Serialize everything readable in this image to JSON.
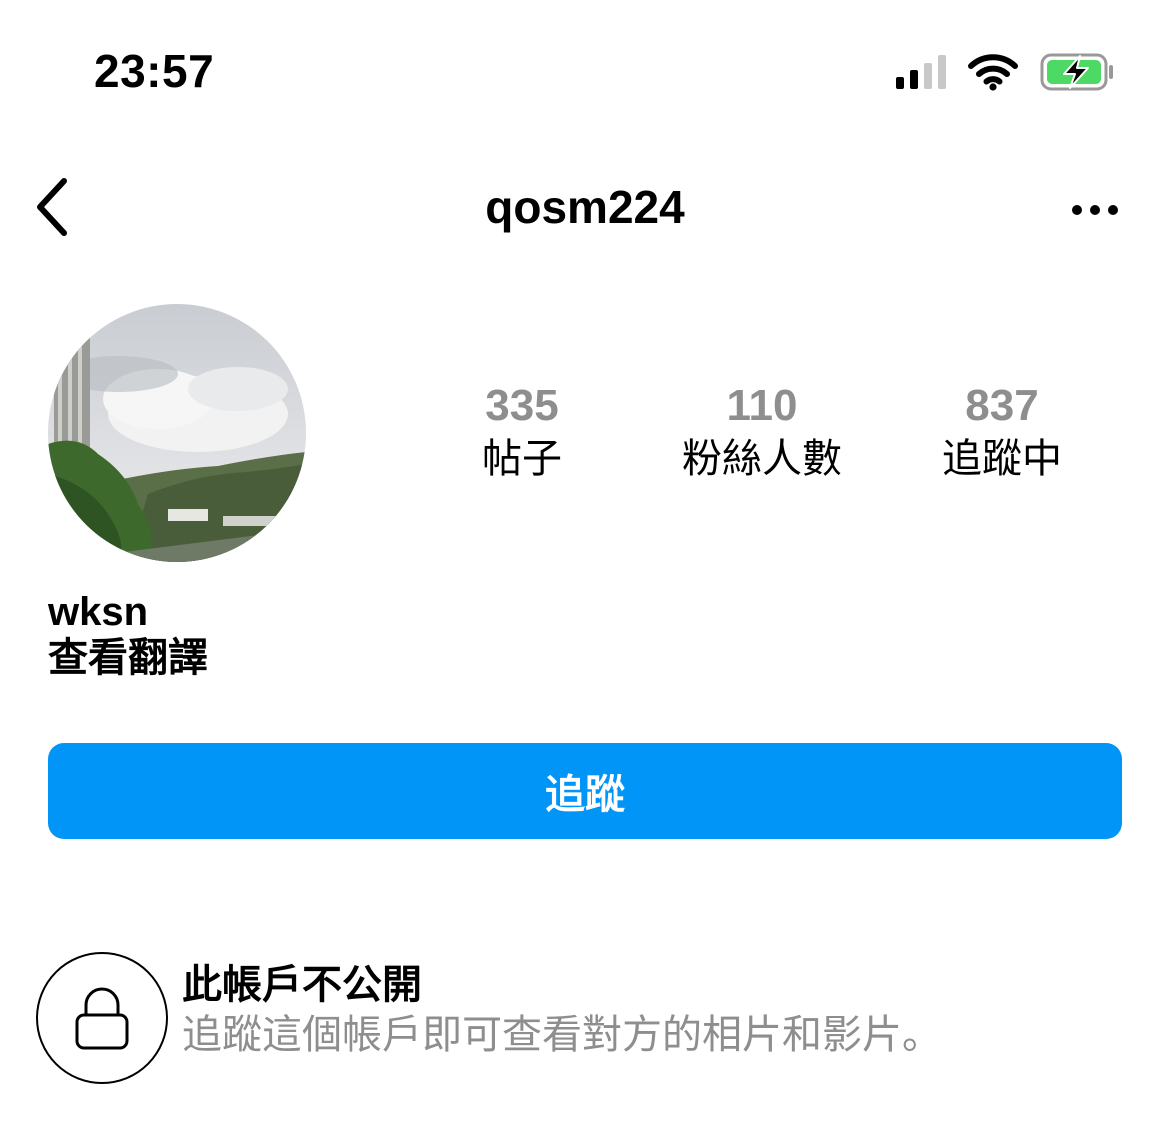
{
  "status_bar": {
    "time": "23:57",
    "icons": [
      "cellular-signal-icon",
      "wifi-icon",
      "battery-charging-icon"
    ],
    "battery_color": "#4cd964"
  },
  "nav": {
    "back_icon": "chevron-left-icon",
    "username": "qosm224",
    "more_icon": "more-horizontal-icon"
  },
  "profile": {
    "stats": [
      {
        "value": "335",
        "label": "帖子"
      },
      {
        "value": "110",
        "label": "粉絲人數"
      },
      {
        "value": "837",
        "label": "追蹤中"
      }
    ],
    "display_name": "wksn",
    "translate_label": "查看翻譯"
  },
  "follow_button": {
    "label": "追蹤",
    "color": "#0095f6"
  },
  "private_notice": {
    "icon": "lock-icon",
    "title": "此帳戶不公開",
    "description": "追蹤這個帳戶即可查看對方的相片和影片。"
  }
}
